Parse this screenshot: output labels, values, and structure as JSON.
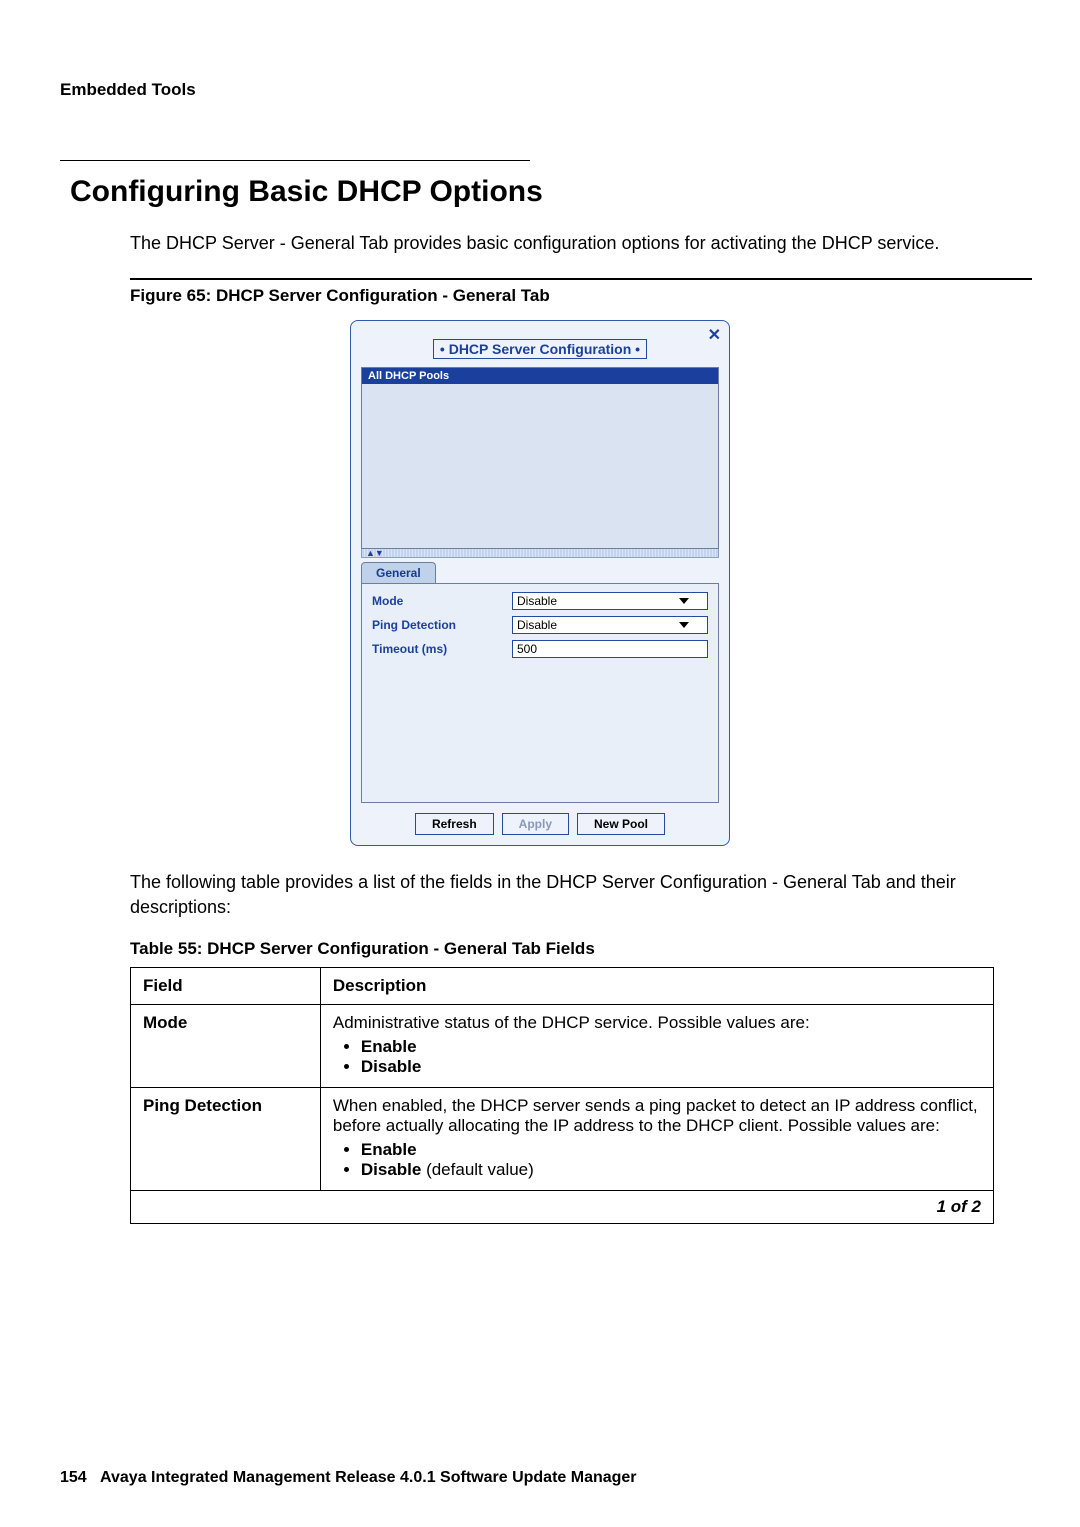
{
  "header": {
    "section": "Embedded Tools"
  },
  "title": "Configuring Basic DHCP Options",
  "intro": "The DHCP Server - General Tab provides basic configuration options for activating the DHCP service.",
  "figure_caption": "Figure 65: DHCP Server Configuration - General Tab",
  "dialog": {
    "title": "• DHCP Server Configuration •",
    "pool_list_header": "All DHCP Pools",
    "tab": "General",
    "fields": {
      "mode_label": "Mode",
      "mode_value": "Disable",
      "ping_label": "Ping Detection",
      "ping_value": "Disable",
      "timeout_label": "Timeout (ms)",
      "timeout_value": "500"
    },
    "buttons": {
      "refresh": "Refresh",
      "apply": "Apply",
      "new_pool": "New Pool"
    }
  },
  "after_figure": "The following table provides a list of the fields in the DHCP Server Configuration - General Tab and their descriptions:",
  "table_caption": "Table 55: DHCP Server Configuration - General Tab Fields",
  "table": {
    "head_field": "Field",
    "head_desc": "Description",
    "rows": [
      {
        "field": "Mode",
        "desc_lead": "Administrative status of the DHCP service. Possible values are:",
        "bullets": [
          {
            "bold": "Enable",
            "tail": ""
          },
          {
            "bold": "Disable",
            "tail": ""
          }
        ]
      },
      {
        "field": "Ping Detection",
        "desc_lead": "When enabled, the DHCP server sends a ping packet to detect an IP address conflict, before actually allocating the IP address to the DHCP client. Possible values are:",
        "bullets": [
          {
            "bold": "Enable",
            "tail": ""
          },
          {
            "bold": "Disable",
            "tail": " (default value)"
          }
        ]
      }
    ],
    "foot": "1 of 2"
  },
  "footer": {
    "page_no": "154",
    "book": "Avaya Integrated Management Release 4.0.1 Software Update Manager"
  }
}
